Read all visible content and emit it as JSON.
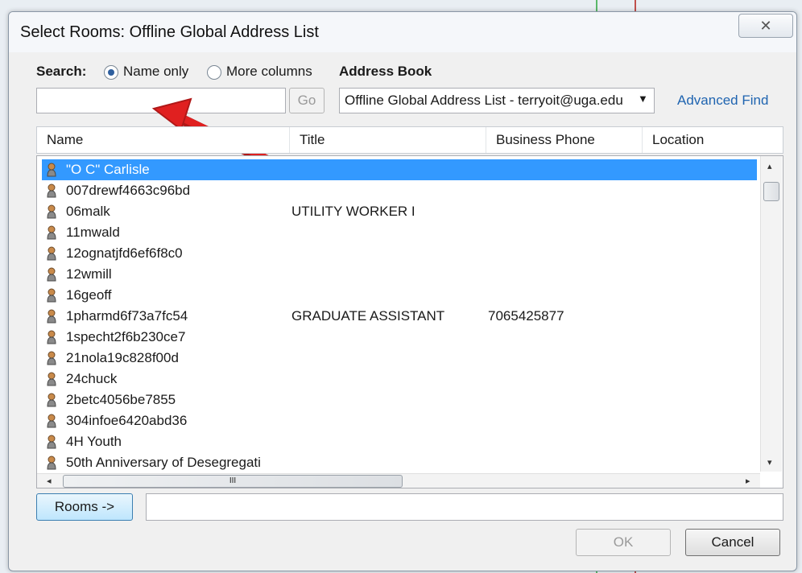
{
  "window": {
    "title": "Select Rooms: Offline Global Address List",
    "close_glyph": "✕"
  },
  "search": {
    "label": "Search:",
    "radio_name_only": "Name only",
    "radio_more_columns": "More columns",
    "selected": "name_only",
    "input_value": "",
    "go_label": "Go"
  },
  "address_book": {
    "label": "Address Book",
    "selected": "Offline Global Address List - terryoit@uga.edu",
    "advanced_find": "Advanced Find"
  },
  "columns": [
    "Name",
    "Title",
    "Business Phone",
    "Location"
  ],
  "rows": [
    {
      "name": "\"O C\" Carlisle",
      "title": "",
      "phone": "",
      "selected": true
    },
    {
      "name": "007drewf4663c96bd",
      "title": "",
      "phone": ""
    },
    {
      "name": "06malk",
      "title": "UTILITY WORKER I",
      "phone": ""
    },
    {
      "name": "11mwald",
      "title": "",
      "phone": ""
    },
    {
      "name": "12ognatjfd6ef6f8c0",
      "title": "",
      "phone": ""
    },
    {
      "name": "12wmill",
      "title": "",
      "phone": ""
    },
    {
      "name": "16geoff",
      "title": "",
      "phone": ""
    },
    {
      "name": "1pharmd6f73a7fc54",
      "title": "GRADUATE ASSISTANT",
      "phone": "7065425877"
    },
    {
      "name": "1specht2f6b230ce7",
      "title": "",
      "phone": ""
    },
    {
      "name": "21nola19c828f00d",
      "title": "",
      "phone": ""
    },
    {
      "name": "24chuck",
      "title": "",
      "phone": ""
    },
    {
      "name": "2betc4056be7855",
      "title": "",
      "phone": ""
    },
    {
      "name": "304infoe6420abd36",
      "title": "",
      "phone": ""
    },
    {
      "name": "4H Youth",
      "title": "",
      "phone": ""
    },
    {
      "name": "50th Anniversary of Desegregati",
      "title": "",
      "phone": ""
    }
  ],
  "scroll": {
    "hthumb_glyph": "III",
    "left_glyph": "◂",
    "right_glyph": "▸",
    "up_glyph": "▴",
    "down_glyph": "▾"
  },
  "rooms": {
    "button_label": "Rooms ->",
    "value": ""
  },
  "footer": {
    "ok_label": "OK",
    "cancel_label": "Cancel"
  },
  "colors": {
    "selection": "#3399ff",
    "link": "#1f64b0",
    "annotation_arrow": "#e02020"
  }
}
